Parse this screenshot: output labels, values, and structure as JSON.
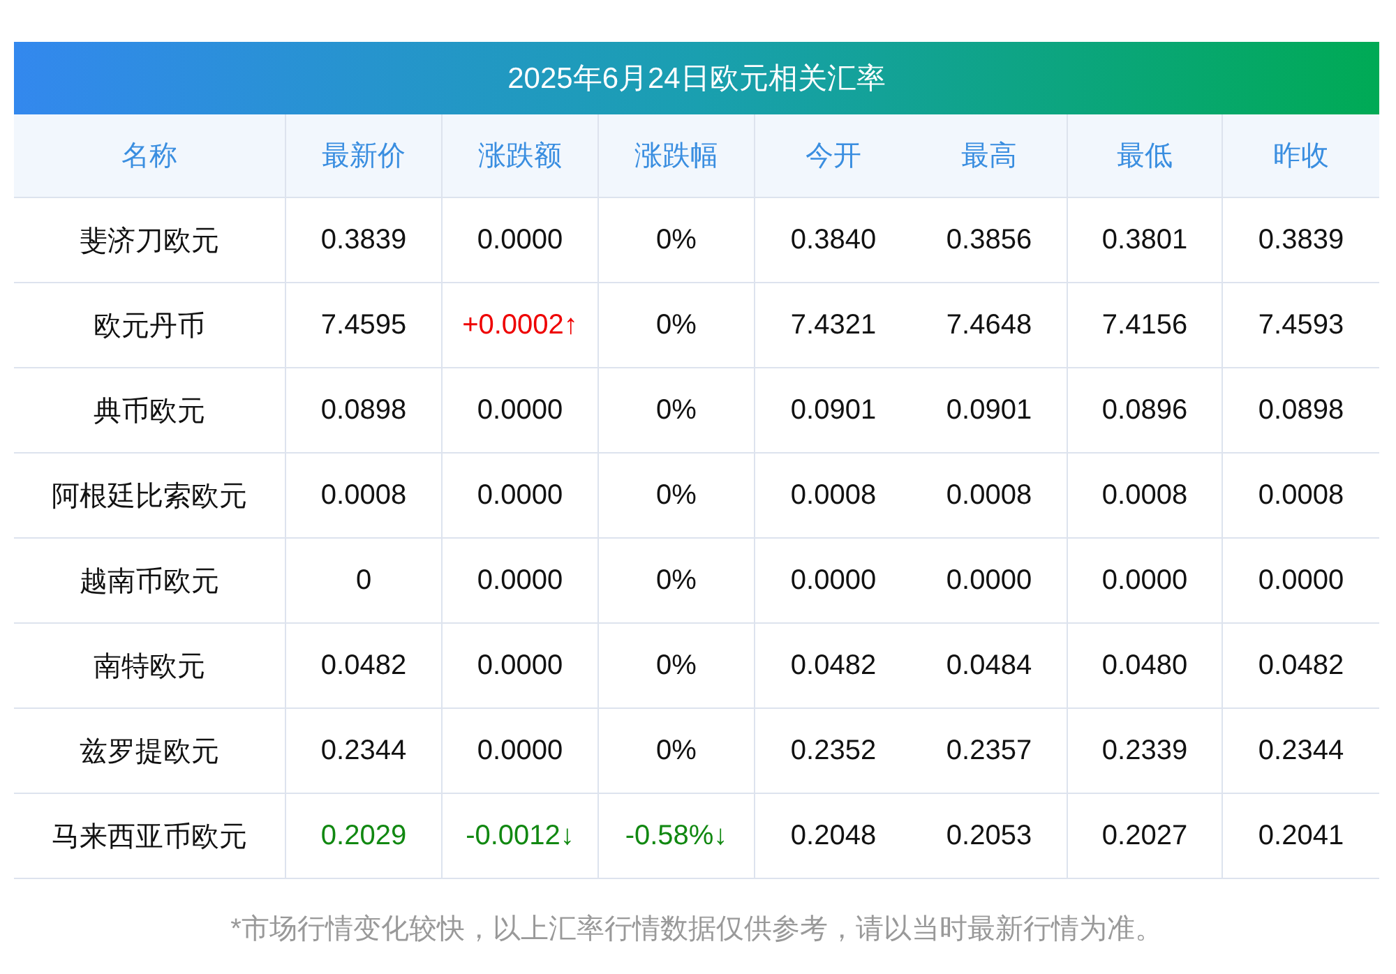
{
  "title": "2025年6月24日欧元相关汇率",
  "columns": [
    "名称",
    "最新价",
    "涨跌额",
    "涨跌幅",
    "今开",
    "最高",
    "最低",
    "昨收"
  ],
  "rows": [
    [
      {
        "text": "斐济刀欧元",
        "color": "#111111"
      },
      {
        "text": "0.3839",
        "color": "#111111"
      },
      {
        "text": "0.0000",
        "color": "#111111"
      },
      {
        "text": "0%",
        "color": "#111111"
      },
      {
        "text": "0.3840",
        "color": "#111111"
      },
      {
        "text": "0.3856",
        "color": "#111111"
      },
      {
        "text": "0.3801",
        "color": "#111111"
      },
      {
        "text": "0.3839",
        "color": "#111111"
      }
    ],
    [
      {
        "text": "欧元丹币",
        "color": "#111111"
      },
      {
        "text": "7.4595",
        "color": "#111111"
      },
      {
        "text": "+0.0002↑",
        "color": "#ee0000"
      },
      {
        "text": "0%",
        "color": "#111111"
      },
      {
        "text": "7.4321",
        "color": "#111111"
      },
      {
        "text": "7.4648",
        "color": "#111111"
      },
      {
        "text": "7.4156",
        "color": "#111111"
      },
      {
        "text": "7.4593",
        "color": "#111111"
      }
    ],
    [
      {
        "text": "典币欧元",
        "color": "#111111"
      },
      {
        "text": "0.0898",
        "color": "#111111"
      },
      {
        "text": "0.0000",
        "color": "#111111"
      },
      {
        "text": "0%",
        "color": "#111111"
      },
      {
        "text": "0.0901",
        "color": "#111111"
      },
      {
        "text": "0.0901",
        "color": "#111111"
      },
      {
        "text": "0.0896",
        "color": "#111111"
      },
      {
        "text": "0.0898",
        "color": "#111111"
      }
    ],
    [
      {
        "text": "阿根廷比索欧元",
        "color": "#111111"
      },
      {
        "text": "0.0008",
        "color": "#111111"
      },
      {
        "text": "0.0000",
        "color": "#111111"
      },
      {
        "text": "0%",
        "color": "#111111"
      },
      {
        "text": "0.0008",
        "color": "#111111"
      },
      {
        "text": "0.0008",
        "color": "#111111"
      },
      {
        "text": "0.0008",
        "color": "#111111"
      },
      {
        "text": "0.0008",
        "color": "#111111"
      }
    ],
    [
      {
        "text": "越南币欧元",
        "color": "#111111"
      },
      {
        "text": "0",
        "color": "#111111"
      },
      {
        "text": "0.0000",
        "color": "#111111"
      },
      {
        "text": "0%",
        "color": "#111111"
      },
      {
        "text": "0.0000",
        "color": "#111111"
      },
      {
        "text": "0.0000",
        "color": "#111111"
      },
      {
        "text": "0.0000",
        "color": "#111111"
      },
      {
        "text": "0.0000",
        "color": "#111111"
      }
    ],
    [
      {
        "text": "南特欧元",
        "color": "#111111"
      },
      {
        "text": "0.0482",
        "color": "#111111"
      },
      {
        "text": "0.0000",
        "color": "#111111"
      },
      {
        "text": "0%",
        "color": "#111111"
      },
      {
        "text": "0.0482",
        "color": "#111111"
      },
      {
        "text": "0.0484",
        "color": "#111111"
      },
      {
        "text": "0.0480",
        "color": "#111111"
      },
      {
        "text": "0.0482",
        "color": "#111111"
      }
    ],
    [
      {
        "text": "兹罗提欧元",
        "color": "#111111"
      },
      {
        "text": "0.2344",
        "color": "#111111"
      },
      {
        "text": "0.0000",
        "color": "#111111"
      },
      {
        "text": "0%",
        "color": "#111111"
      },
      {
        "text": "0.2352",
        "color": "#111111"
      },
      {
        "text": "0.2357",
        "color": "#111111"
      },
      {
        "text": "0.2339",
        "color": "#111111"
      },
      {
        "text": "0.2344",
        "color": "#111111"
      }
    ],
    [
      {
        "text": "马来西亚币欧元",
        "color": "#111111"
      },
      {
        "text": "0.2029",
        "color": "#118811"
      },
      {
        "text": "-0.0012↓",
        "color": "#118811"
      },
      {
        "text": "-0.58%↓",
        "color": "#118811"
      },
      {
        "text": "0.2048",
        "color": "#111111"
      },
      {
        "text": "0.2053",
        "color": "#111111"
      },
      {
        "text": "0.2027",
        "color": "#111111"
      },
      {
        "text": "0.2041",
        "color": "#111111"
      }
    ]
  ],
  "footnote": "*市场行情变化较快，以上汇率行情数据仅供参考，请以当时最新行情为准。"
}
